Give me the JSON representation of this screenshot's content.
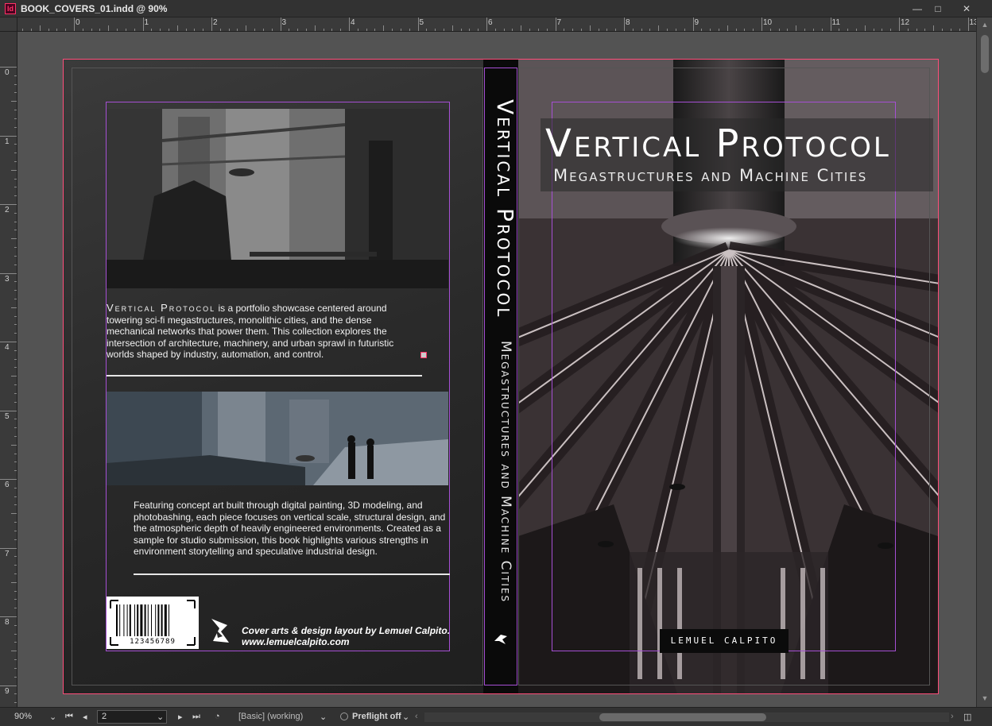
{
  "window": {
    "app_icon": "Id",
    "title": "BOOK_COVERS_01.indd @ 90%",
    "controls": {
      "minimize": "—",
      "maximize": "□",
      "close": "✕"
    }
  },
  "rulers": {
    "top_labels": [
      "0",
      "1",
      "2",
      "3",
      "4",
      "5",
      "6",
      "7",
      "8",
      "9",
      "10",
      "11",
      "12",
      "13"
    ],
    "left_labels": [
      "0",
      "1",
      "2",
      "3",
      "4",
      "5",
      "6",
      "7",
      "8",
      "9"
    ]
  },
  "back_cover": {
    "blurb1_lead": "Vertical Protocol",
    "blurb1_rest": " is a portfolio showcase centered around towering sci-fi megastructures, monolithic cities, and the dense mechanical networks that power them. This collection explores the intersection of architecture, machinery, and urban sprawl in futuristic worlds shaped by industry, automation, and control.",
    "blurb2": "Featuring concept art built through digital painting, 3D modeling, and photobashing, each piece focuses on vertical scale, structural design, and the atmospheric depth of heavily engineered environments. Created as a sample for studio submission, this book highlights various strengths in environment storytelling and speculative industrial design.",
    "barcode_number": "123456789",
    "credit_line1": "Cover arts & design layout by Lemuel Calpito.",
    "credit_line2": "www.lemuelcalpito.com"
  },
  "spine": {
    "title": "Vertical Protocol",
    "subtitle": "Megastructures and Machine Cities"
  },
  "front_cover": {
    "title": "Vertical Protocol",
    "subtitle": "Megastructures and Machine Cities",
    "author": "LEMUEL CALPITO"
  },
  "statusbar": {
    "zoom": "90%",
    "page": "2",
    "style": "[Basic] (working)",
    "preflight": "Preflight off"
  },
  "colors": {
    "bleed_guide": "#ff4d7a",
    "margin_guide": "#a64fd4",
    "pasteboard": "#535353",
    "chrome": "#323232"
  }
}
